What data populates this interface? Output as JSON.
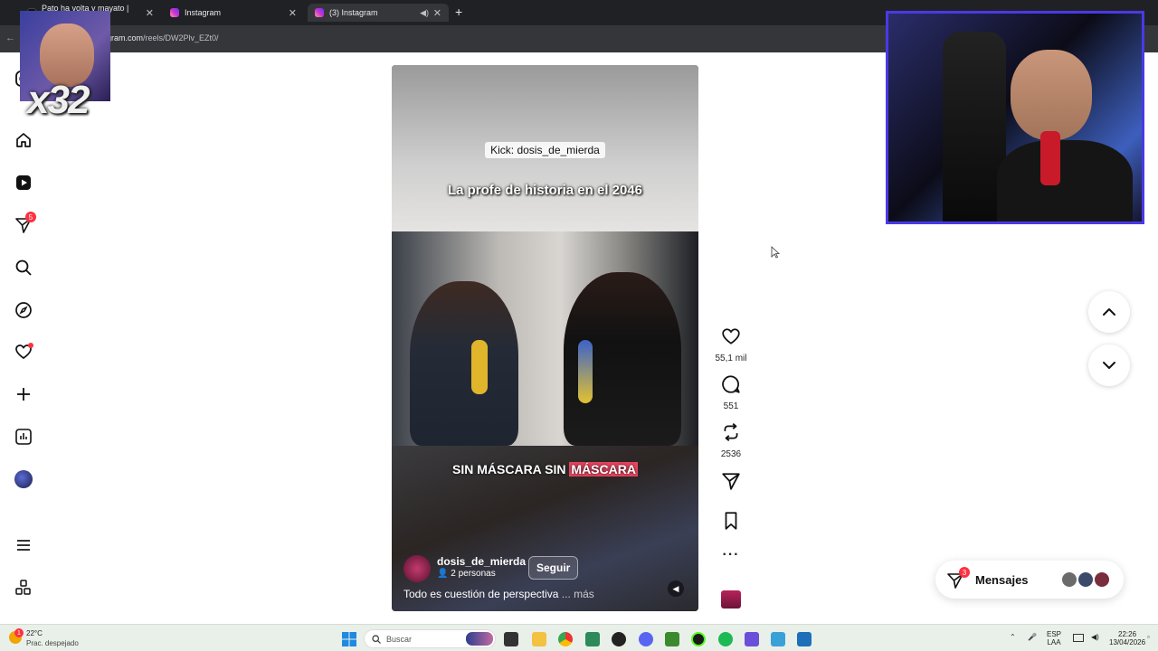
{
  "browser": {
    "tabs": [
      {
        "title": "Pato ha volta y mayato | TikTok"
      },
      {
        "title": "Instagram"
      },
      {
        "title": "(3) Instagram"
      }
    ],
    "url_prefix": "...",
    "url_domain": "gram.com",
    "url_path": "/reels/DW2Plv_EZt0/"
  },
  "sidebar": {
    "notifications_badge": "5"
  },
  "reel": {
    "kick_label": "Kick: dosis_de_mierda",
    "caption_top": "La profe de historia en el 2046",
    "caption_bottom_a": "SIN MÁSCARA SIN ",
    "caption_bottom_b": "MÁSCARA",
    "username": "dosis_de_mierda",
    "people": "2 personas",
    "follow_label": "Seguir",
    "description": "Todo es cuestión de perspectiva",
    "more": "... más"
  },
  "actions": {
    "likes": "55,1 mil",
    "comments": "551",
    "reposts": "2536"
  },
  "messages": {
    "label": "Mensajes",
    "badge": "3"
  },
  "overlay": {
    "multiplier": "x32"
  },
  "taskbar": {
    "weather_temp": "22°C",
    "weather_desc": "Prac. despejado",
    "weather_badge": "1",
    "search_placeholder": "Buscar",
    "lang_top": "ESP",
    "lang_bottom": "LAA",
    "time": "22:26",
    "date": "13/04/2026"
  },
  "colors": {
    "accent_red": "#ff3040",
    "cam_border": "#4a39e6"
  }
}
